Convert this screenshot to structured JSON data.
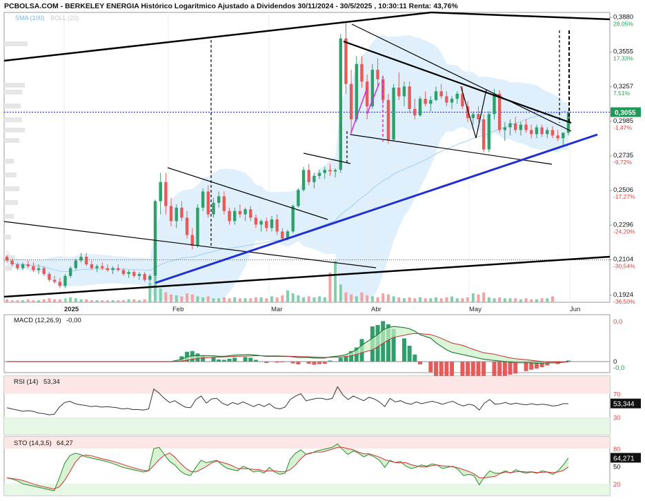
{
  "header": {
    "title": "PCBOLSA.COM - BERKELEY ENERGIA Histórico Logarítmico Ajustado a Dividendos 30/11/2024 - 30/5/2025 , 10:30:11 Renta: 43,76%",
    "indicators_label": "SMA (100)",
    "indicators_label2": "BOLL (20)"
  },
  "colors": {
    "up": "#2e9e6b",
    "down": "#e85a5a",
    "band": "#d9ecfa",
    "support": "#2030d0",
    "price_badge": "#1f9a56",
    "green_text": "#2a9a56",
    "red_text": "#e04040"
  },
  "chart_data": [
    {
      "type": "candlestick",
      "name": "price",
      "scale": "log",
      "ylim": [
        0.189,
        0.393
      ],
      "last_price": "0,3055",
      "y_ticks": [
        {
          "value": 0.388,
          "label": "0,3880",
          "pct": "28,05%",
          "sign": "up"
        },
        {
          "value": 0.3555,
          "label": "0,3555",
          "pct": "17,33%",
          "sign": "up"
        },
        {
          "value": 0.3257,
          "label": "0,3257",
          "pct": "7,51%",
          "sign": "up"
        },
        {
          "value": 0.2985,
          "label": "0,2985",
          "pct": "-1,47%",
          "sign": "down"
        },
        {
          "value": 0.2735,
          "label": "0,2735",
          "pct": "-9,72%",
          "sign": "down"
        },
        {
          "value": 0.2506,
          "label": "0,2506",
          "pct": "-17,27%",
          "sign": "down"
        },
        {
          "value": 0.2296,
          "label": "0,2296",
          "pct": "-24,20%",
          "sign": "down"
        },
        {
          "value": 0.2104,
          "label": "0,2104",
          "pct": "-30,54%",
          "sign": "down"
        },
        {
          "value": 0.1924,
          "label": "0,1924",
          "pct": "-36,50%",
          "sign": "down"
        }
      ],
      "x_labels": [
        "2025",
        "Feb",
        "Mar",
        "Abr",
        "May",
        "Jun"
      ],
      "candles": [
        [
          0.212,
          0.213,
          0.209,
          0.21
        ],
        [
          0.21,
          0.211,
          0.207,
          0.208
        ],
        [
          0.208,
          0.209,
          0.205,
          0.206
        ],
        [
          0.206,
          0.209,
          0.205,
          0.208
        ],
        [
          0.208,
          0.21,
          0.206,
          0.207
        ],
        [
          0.207,
          0.209,
          0.204,
          0.205
        ],
        [
          0.205,
          0.208,
          0.203,
          0.206
        ],
        [
          0.206,
          0.207,
          0.202,
          0.203
        ],
        [
          0.203,
          0.204,
          0.199,
          0.2
        ],
        [
          0.2,
          0.202,
          0.198,
          0.199
        ],
        [
          0.199,
          0.201,
          0.196,
          0.197
        ],
        [
          0.197,
          0.203,
          0.196,
          0.202
        ],
        [
          0.202,
          0.207,
          0.201,
          0.206
        ],
        [
          0.206,
          0.211,
          0.205,
          0.21
        ],
        [
          0.21,
          0.214,
          0.209,
          0.212
        ],
        [
          0.212,
          0.214,
          0.207,
          0.208
        ],
        [
          0.208,
          0.21,
          0.205,
          0.206
        ],
        [
          0.206,
          0.208,
          0.204,
          0.207
        ],
        [
          0.207,
          0.209,
          0.205,
          0.206
        ],
        [
          0.206,
          0.208,
          0.204,
          0.205
        ],
        [
          0.205,
          0.207,
          0.203,
          0.206
        ],
        [
          0.206,
          0.208,
          0.204,
          0.205
        ],
        [
          0.205,
          0.206,
          0.202,
          0.203
        ],
        [
          0.203,
          0.205,
          0.201,
          0.204
        ],
        [
          0.204,
          0.205,
          0.201,
          0.202
        ],
        [
          0.202,
          0.204,
          0.2,
          0.203
        ],
        [
          0.203,
          0.204,
          0.199,
          0.2
        ],
        [
          0.2,
          0.203,
          0.199,
          0.202
        ],
        [
          0.202,
          0.245,
          0.201,
          0.244
        ],
        [
          0.244,
          0.262,
          0.236,
          0.256
        ],
        [
          0.256,
          0.262,
          0.236,
          0.241
        ],
        [
          0.241,
          0.246,
          0.229,
          0.232
        ],
        [
          0.232,
          0.242,
          0.228,
          0.24
        ],
        [
          0.24,
          0.244,
          0.232,
          0.234
        ],
        [
          0.234,
          0.238,
          0.222,
          0.224
        ],
        [
          0.224,
          0.228,
          0.216,
          0.218
        ],
        [
          0.218,
          0.242,
          0.217,
          0.24
        ],
        [
          0.24,
          0.252,
          0.238,
          0.25
        ],
        [
          0.25,
          0.254,
          0.234,
          0.236
        ],
        [
          0.236,
          0.246,
          0.234,
          0.243
        ],
        [
          0.243,
          0.25,
          0.24,
          0.247
        ],
        [
          0.247,
          0.25,
          0.236,
          0.238
        ],
        [
          0.238,
          0.24,
          0.23,
          0.232
        ],
        [
          0.232,
          0.24,
          0.23,
          0.238
        ],
        [
          0.238,
          0.242,
          0.234,
          0.236
        ],
        [
          0.236,
          0.24,
          0.232,
          0.239
        ],
        [
          0.239,
          0.241,
          0.232,
          0.234
        ],
        [
          0.234,
          0.236,
          0.228,
          0.23
        ],
        [
          0.23,
          0.233,
          0.226,
          0.232
        ],
        [
          0.232,
          0.234,
          0.226,
          0.228
        ],
        [
          0.228,
          0.235,
          0.226,
          0.233
        ],
        [
          0.233,
          0.236,
          0.224,
          0.226
        ],
        [
          0.226,
          0.228,
          0.221,
          0.222
        ],
        [
          0.222,
          0.227,
          0.221,
          0.226
        ],
        [
          0.226,
          0.242,
          0.225,
          0.241
        ],
        [
          0.241,
          0.252,
          0.24,
          0.251
        ],
        [
          0.251,
          0.266,
          0.25,
          0.264
        ],
        [
          0.264,
          0.268,
          0.254,
          0.256
        ],
        [
          0.256,
          0.262,
          0.252,
          0.26
        ],
        [
          0.26,
          0.264,
          0.258,
          0.262
        ],
        [
          0.262,
          0.266,
          0.258,
          0.264
        ],
        [
          0.264,
          0.268,
          0.26,
          0.263
        ],
        [
          0.263,
          0.265,
          0.259,
          0.264
        ],
        [
          0.264,
          0.372,
          0.262,
          0.368
        ],
        [
          0.368,
          0.384,
          0.32,
          0.328
        ],
        [
          0.328,
          0.34,
          0.29,
          0.3
        ],
        [
          0.3,
          0.352,
          0.298,
          0.345
        ],
        [
          0.345,
          0.352,
          0.325,
          0.33
        ],
        [
          0.33,
          0.336,
          0.3,
          0.31
        ],
        [
          0.31,
          0.345,
          0.308,
          0.34
        ],
        [
          0.34,
          0.35,
          0.325,
          0.332
        ],
        [
          0.332,
          0.335,
          0.312,
          0.315
        ],
        [
          0.315,
          0.32,
          0.282,
          0.285
        ],
        [
          0.285,
          0.328,
          0.284,
          0.325
        ],
        [
          0.325,
          0.338,
          0.315,
          0.318
        ],
        [
          0.318,
          0.33,
          0.31,
          0.326
        ],
        [
          0.326,
          0.33,
          0.305,
          0.308
        ],
        [
          0.308,
          0.316,
          0.3,
          0.303
        ],
        [
          0.303,
          0.318,
          0.302,
          0.316
        ],
        [
          0.316,
          0.322,
          0.31,
          0.312
        ],
        [
          0.312,
          0.318,
          0.306,
          0.315
        ],
        [
          0.315,
          0.326,
          0.314,
          0.322
        ],
        [
          0.322,
          0.328,
          0.316,
          0.318
        ],
        [
          0.318,
          0.322,
          0.31,
          0.313
        ],
        [
          0.313,
          0.318,
          0.308,
          0.316
        ],
        [
          0.316,
          0.322,
          0.312,
          0.32
        ],
        [
          0.32,
          0.326,
          0.308,
          0.31
        ],
        [
          0.31,
          0.314,
          0.298,
          0.301
        ],
        [
          0.301,
          0.306,
          0.296,
          0.304
        ],
        [
          0.304,
          0.31,
          0.298,
          0.3
        ],
        [
          0.3,
          0.304,
          0.276,
          0.278
        ],
        [
          0.278,
          0.306,
          0.276,
          0.304
        ],
        [
          0.304,
          0.324,
          0.3,
          0.32
        ],
        [
          0.32,
          0.323,
          0.29,
          0.292
        ],
        [
          0.292,
          0.298,
          0.284,
          0.294
        ],
        [
          0.294,
          0.3,
          0.288,
          0.297
        ],
        [
          0.297,
          0.302,
          0.29,
          0.292
        ],
        [
          0.292,
          0.298,
          0.288,
          0.296
        ],
        [
          0.296,
          0.3,
          0.29,
          0.292
        ],
        [
          0.292,
          0.296,
          0.286,
          0.289
        ],
        [
          0.289,
          0.296,
          0.286,
          0.294
        ],
        [
          0.294,
          0.296,
          0.287,
          0.289
        ],
        [
          0.289,
          0.294,
          0.286,
          0.292
        ],
        [
          0.292,
          0.295,
          0.286,
          0.288
        ],
        [
          0.288,
          0.292,
          0.284,
          0.286
        ],
        [
          0.286,
          0.29,
          0.28,
          0.29
        ],
        [
          0.29,
          0.304,
          0.288,
          0.3055
        ]
      ],
      "volume": [
        3,
        2,
        2,
        2,
        3,
        2,
        2,
        3,
        4,
        3,
        3,
        4,
        5,
        4,
        3,
        3,
        2,
        2,
        2,
        2,
        2,
        2,
        2,
        3,
        3,
        2,
        3,
        20,
        26,
        14,
        10,
        8,
        7,
        6,
        9,
        8,
        6,
        5,
        6,
        4,
        4,
        5,
        4,
        5,
        4,
        4,
        4,
        5,
        5,
        4,
        6,
        5,
        7,
        12,
        9,
        7,
        5,
        6,
        5,
        6,
        5,
        30,
        42,
        18,
        10,
        8,
        6,
        10,
        7,
        6,
        5,
        9,
        8,
        6,
        5,
        4,
        5,
        4,
        5,
        4,
        4,
        5,
        4,
        5,
        6,
        4,
        4,
        5,
        9,
        8,
        10,
        5,
        4,
        5,
        4,
        4,
        4,
        3,
        4,
        3,
        3,
        4,
        4,
        6
      ]
    },
    {
      "type": "histogram+line",
      "name": "MACD",
      "title": "MACD (12,26,9)",
      "value": "-0,00",
      "y_ticks": [
        {
          "value": 0.0,
          "label": "0,0",
          "sign": "down"
        },
        {
          "value": 0.0,
          "label": "0"
        },
        {
          "value": -0.0,
          "label": "-0,0",
          "sign": "up"
        }
      ],
      "macd": [
        0,
        0,
        0,
        0,
        0,
        0,
        0,
        0,
        0,
        0,
        0,
        0,
        0,
        0,
        0,
        0,
        0,
        0,
        0,
        0,
        0,
        0,
        0,
        0,
        0,
        0,
        0,
        0.2,
        0.4,
        0.5,
        0.5,
        0.5,
        0.5,
        0.45,
        0.45,
        0.5,
        0.55,
        0.6,
        0.6,
        0.55,
        0.5,
        0.45,
        0.45,
        0.45,
        0.45,
        0.4,
        0.35,
        0.35,
        0.3,
        0.3,
        0.3,
        0.4,
        0.5,
        0.6,
        0.8,
        1.0,
        1.4,
        2.0,
        2.3,
        2.7,
        2.9,
        3.0,
        2.9,
        2.8,
        2.6,
        2.3,
        2.0,
        1.6,
        1.3,
        1.0,
        0.8,
        0.6,
        0.5,
        0.4,
        0.3,
        0.2,
        0.1,
        0.05,
        0,
        -0.05,
        -0.1,
        -0.1,
        -0.12,
        -0.14,
        -0.14,
        -0.12,
        -0.1,
        -0.05,
        0.0
      ],
      "signal": [
        0,
        0,
        0,
        0,
        0,
        0,
        0,
        0,
        0,
        0,
        0,
        0,
        0,
        0,
        0,
        0,
        0,
        0,
        0,
        0,
        0,
        0,
        0,
        0,
        0,
        0,
        0,
        0.05,
        0.12,
        0.2,
        0.27,
        0.32,
        0.36,
        0.39,
        0.4,
        0.42,
        0.44,
        0.47,
        0.49,
        0.5,
        0.5,
        0.49,
        0.48,
        0.47,
        0.46,
        0.45,
        0.43,
        0.41,
        0.39,
        0.37,
        0.36,
        0.37,
        0.39,
        0.43,
        0.5,
        0.6,
        0.76,
        1.0,
        1.26,
        1.55,
        1.84,
        2.07,
        2.24,
        2.35,
        2.4,
        2.38,
        2.3,
        2.16,
        1.98,
        1.78,
        1.58,
        1.39,
        1.21,
        1.05,
        0.9,
        0.76,
        0.63,
        0.52,
        0.42,
        0.32,
        0.24,
        0.17,
        0.11,
        0.06,
        0.02,
        -0.01,
        -0.03,
        -0.04,
        -0.03
      ]
    },
    {
      "type": "line",
      "name": "RSI",
      "title": "RSI (14)",
      "value": "53,34",
      "last_label": "53,344",
      "ylim": [
        0,
        100
      ],
      "y_ticks": [
        {
          "value": 70,
          "label": "70"
        },
        {
          "value": 30,
          "label": "30"
        }
      ],
      "values": [
        46,
        44,
        42,
        40,
        41,
        40,
        37,
        36,
        34,
        35,
        47,
        55,
        57,
        53,
        51,
        50,
        48,
        49,
        47,
        48,
        47,
        46,
        44,
        45,
        43,
        43,
        42,
        44,
        78,
        71,
        62,
        55,
        58,
        52,
        47,
        46,
        60,
        66,
        54,
        61,
        62,
        54,
        50,
        55,
        52,
        56,
        52,
        48,
        52,
        48,
        53,
        46,
        44,
        47,
        60,
        66,
        70,
        58,
        60,
        62,
        62,
        60,
        62,
        82,
        68,
        60,
        66,
        62,
        58,
        64,
        61,
        56,
        48,
        62,
        56,
        58,
        54,
        52,
        56,
        53,
        55,
        57,
        55,
        52,
        55,
        57,
        52,
        49,
        52,
        50,
        42,
        54,
        60,
        52,
        53,
        55,
        52,
        54,
        52,
        51,
        53,
        51,
        52,
        51,
        49,
        50,
        53,
        53
      ]
    },
    {
      "type": "line",
      "name": "STO",
      "title": "STO (14,3,5)",
      "value": "64,27",
      "last_label": "64,271",
      "ylim": [
        0,
        100
      ],
      "y_ticks": [
        {
          "value": 80,
          "label": "80"
        },
        {
          "value": 50,
          "label": "50"
        },
        {
          "value": 20,
          "label": "20"
        }
      ],
      "k": [
        30,
        28,
        25,
        20,
        18,
        16,
        14,
        12,
        10,
        8,
        30,
        55,
        68,
        72,
        70,
        66,
        64,
        62,
        60,
        58,
        55,
        52,
        48,
        46,
        44,
        42,
        40,
        42,
        80,
        82,
        70,
        58,
        52,
        42,
        36,
        34,
        48,
        60,
        56,
        58,
        60,
        52,
        46,
        44,
        42,
        50,
        46,
        40,
        42,
        38,
        48,
        40,
        36,
        38,
        62,
        72,
        78,
        70,
        72,
        76,
        78,
        80,
        82,
        88,
        78,
        70,
        76,
        72,
        66,
        70,
        66,
        60,
        48,
        60,
        56,
        58,
        50,
        46,
        48,
        52,
        50,
        54,
        52,
        46,
        48,
        50,
        44,
        34,
        36,
        34,
        18,
        32,
        42,
        38,
        38,
        42,
        38,
        44,
        40,
        38,
        40,
        38,
        42,
        40,
        36,
        42,
        52,
        64
      ]
    }
  ]
}
